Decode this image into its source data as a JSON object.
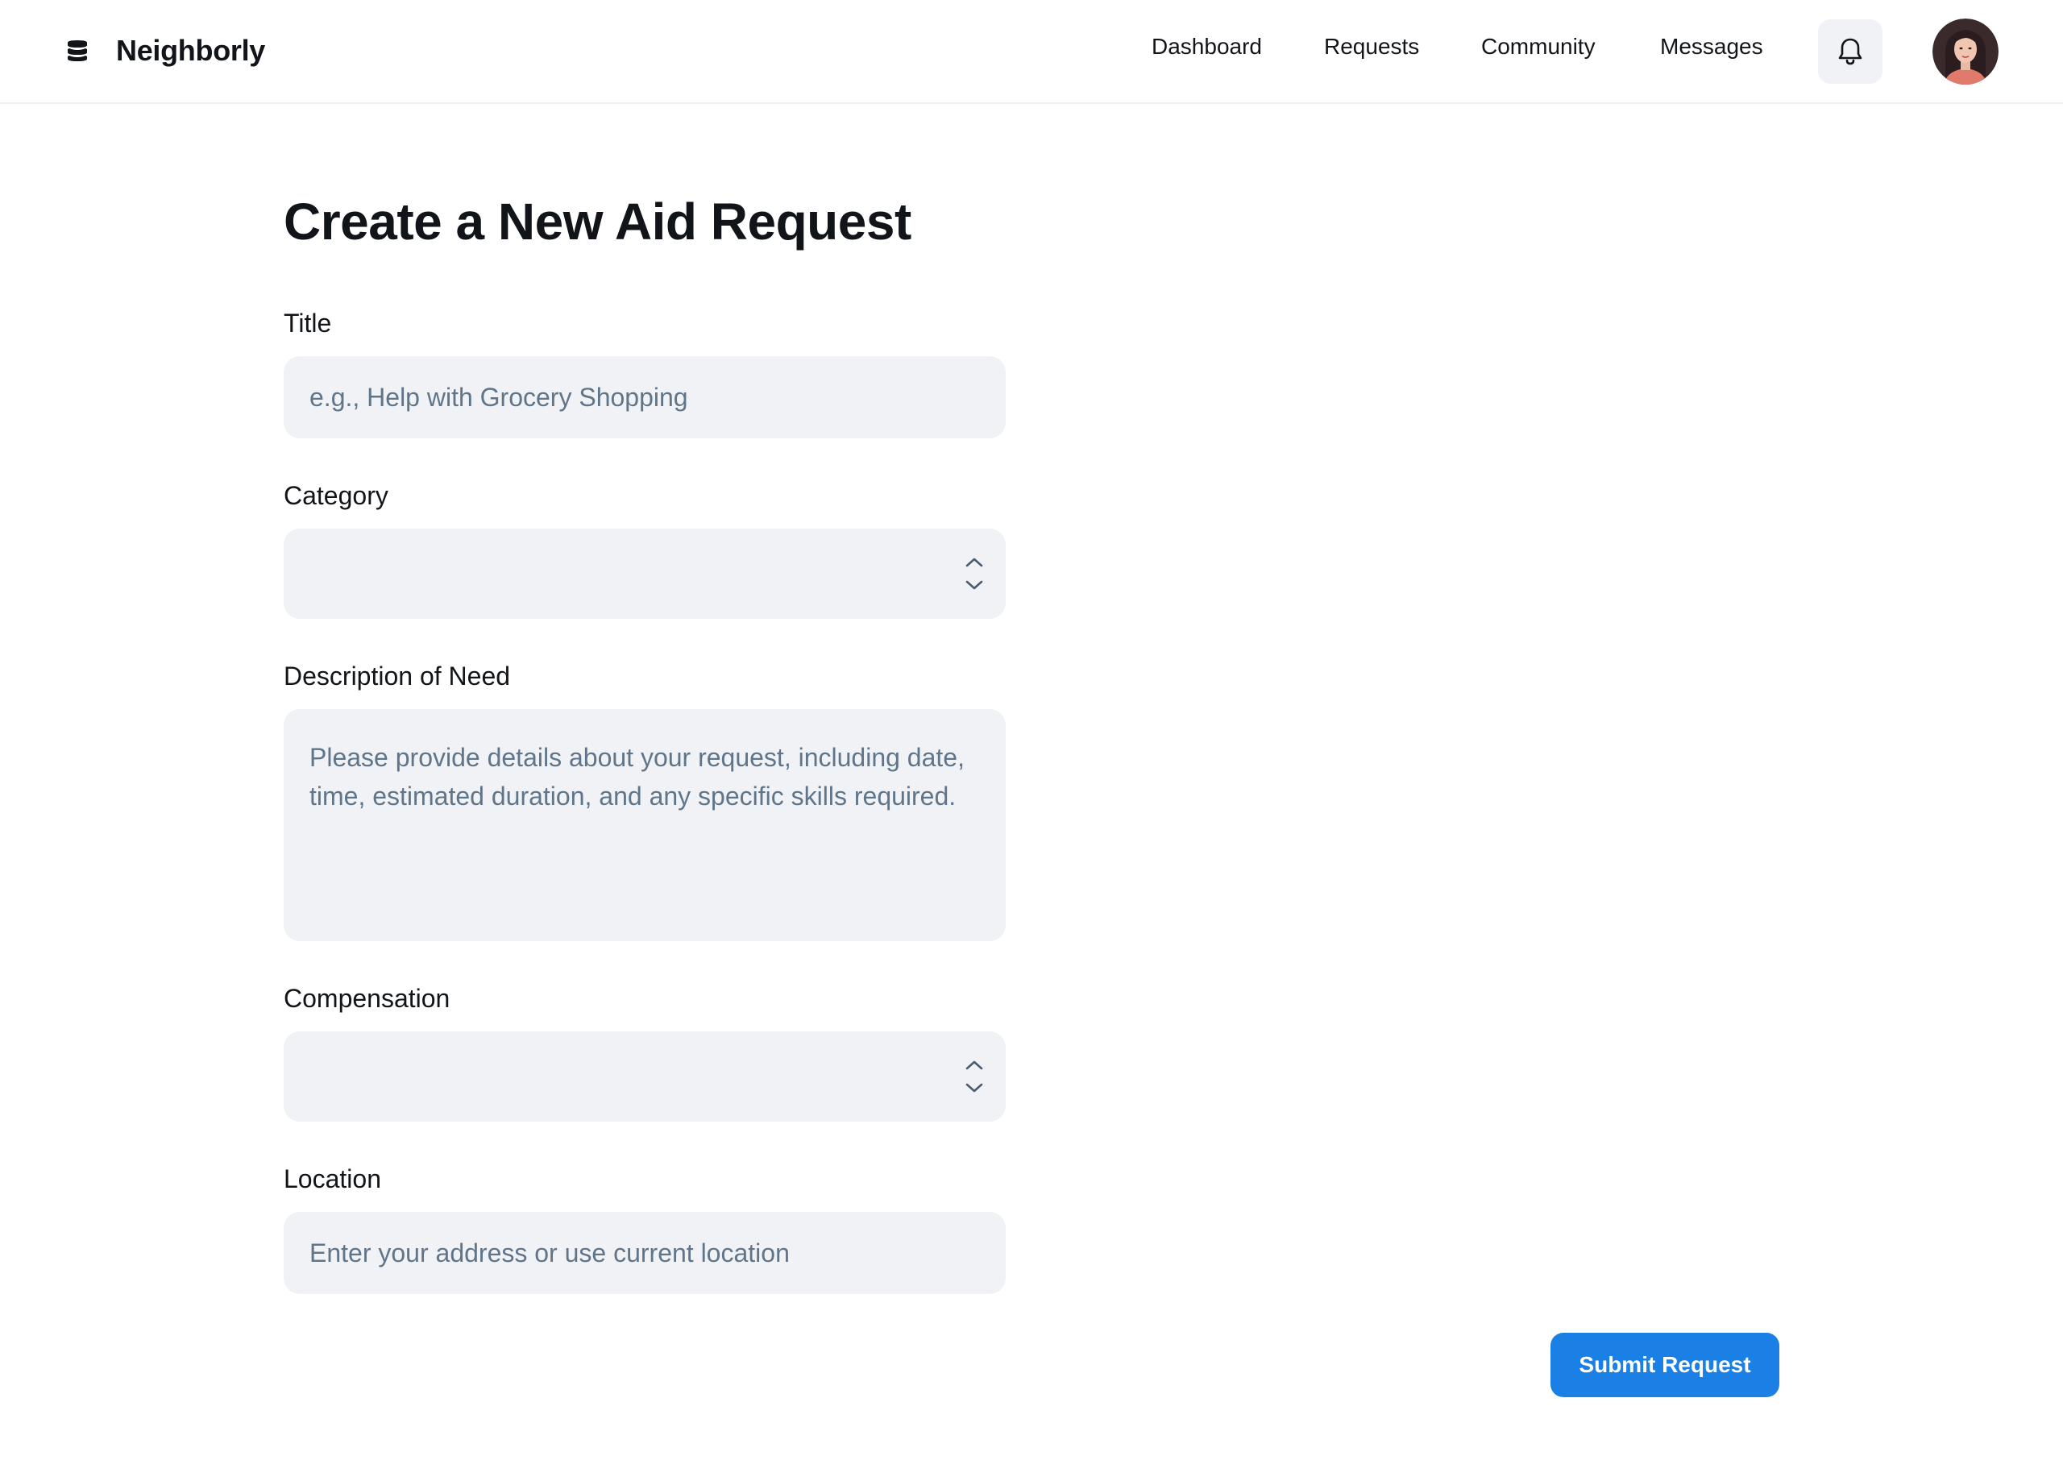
{
  "app": {
    "name": "Neighborly",
    "logo_icon": "stacked-layers-icon"
  },
  "nav": {
    "items": [
      {
        "label": "Dashboard"
      },
      {
        "label": "Requests"
      },
      {
        "label": "Community"
      },
      {
        "label": "Messages"
      }
    ],
    "notifications_icon": "bell-icon",
    "avatar_icon": "user-avatar"
  },
  "form": {
    "title": "Create a New Aid Request",
    "fields": {
      "title": {
        "label": "Title",
        "value": "",
        "placeholder": "e.g., Help with Grocery Shopping"
      },
      "category": {
        "label": "Category",
        "selected": ""
      },
      "description": {
        "label": "Description of Need",
        "value": "",
        "placeholder": "Please provide details about your request, including date, time, estimated duration, and any specific skills required."
      },
      "compensation": {
        "label": "Compensation",
        "selected": ""
      },
      "location": {
        "label": "Location",
        "value": "",
        "placeholder": "Enter your address or use current location"
      }
    },
    "submit_label": "Submit Request"
  },
  "colors": {
    "accent": "#1a80e5",
    "field_bg": "#f0f2f5",
    "placeholder": "#60758a",
    "text": "#111418"
  }
}
